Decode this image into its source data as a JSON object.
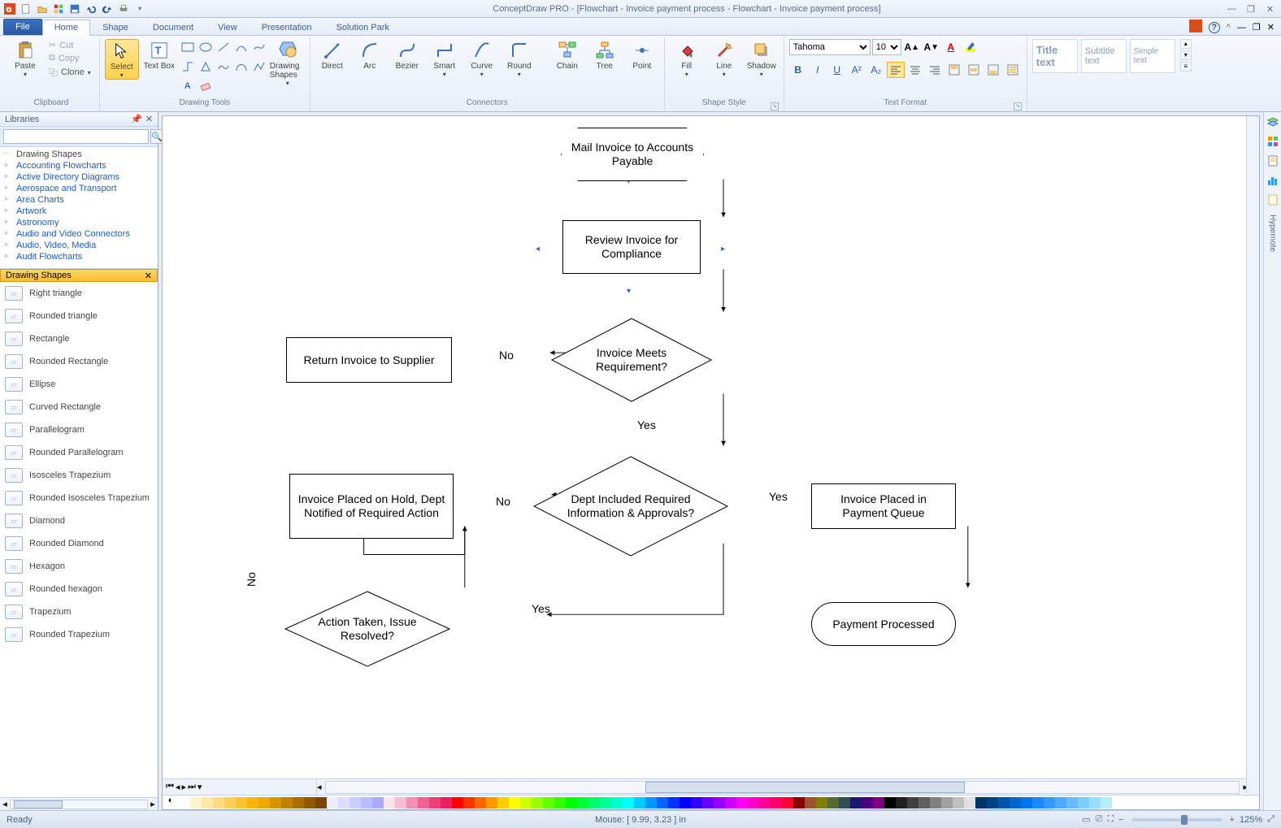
{
  "app": {
    "title": "ConceptDraw PRO - [Flowchart - Invoice payment process - Flowchart - Invoice payment process]"
  },
  "tabs": {
    "file": "File",
    "items": [
      "Home",
      "Shape",
      "Document",
      "View",
      "Presentation",
      "Solution Park"
    ],
    "active": 0
  },
  "ribbon": {
    "clipboard": {
      "paste": "Paste",
      "cut": "Cut",
      "copy": "Copy",
      "clone": "Clone",
      "label": "Clipboard"
    },
    "drawing": {
      "select": "Select",
      "textbox": "Text Box",
      "drawing_shapes": "Drawing Shapes",
      "label": "Drawing Tools"
    },
    "connectors": {
      "direct": "Direct",
      "arc": "Arc",
      "bezier": "Bezier",
      "smart": "Smart",
      "curve": "Curve",
      "round": "Round",
      "chain": "Chain",
      "tree": "Tree",
      "point": "Point",
      "label": "Connectors"
    },
    "shapestyle": {
      "fill": "Fill",
      "line": "Line",
      "shadow": "Shadow",
      "label": "Shape Style"
    },
    "textformat": {
      "font": "Tahoma",
      "size": "10",
      "label": "Text Format"
    },
    "styles": {
      "title": "Title text",
      "subtitle": "Subtitle text",
      "simple": "Simple text"
    }
  },
  "side": {
    "header": "Libraries",
    "tree_header": "Drawing Shapes",
    "tree": [
      "Accounting Flowcharts",
      "Active Directory Diagrams",
      "Aerospace and Transport",
      "Area Charts",
      "Artwork",
      "Astronomy",
      "Audio and Video Connectors",
      "Audio, Video, Media",
      "Audit Flowcharts"
    ],
    "palette_header": "Drawing Shapes",
    "palette": [
      "Right triangle",
      "Rounded triangle",
      "Rectangle",
      "Rounded Rectangle",
      "Ellipse",
      "Curved Rectangle",
      "Parallelogram",
      "Rounded Parallelogram",
      "Isosceles Trapezium",
      "Rounded Isosceles Trapezium",
      "Diamond",
      "Rounded Diamond",
      "Hexagon",
      "Rounded hexagon",
      "Trapezium",
      "Rounded Trapezium"
    ]
  },
  "flow": {
    "n1": "Mail Invoice to Accounts Payable",
    "n2": "Review Invoice for Compliance",
    "n3": "Invoice Meets Requirement?",
    "n4": "Return Invoice to Supplier",
    "n5": "Dept Included Required Information & Approvals?",
    "n6": "Invoice Placed on Hold, Dept Notified of Required Action",
    "n7": "Invoice Placed in Payment Queue",
    "n8": "Action Taken, Issue Resolved?",
    "n9": "Payment Processed",
    "yes": "Yes",
    "no": "No"
  },
  "status": {
    "ready": "Ready",
    "mouse": "Mouse: [ 9.99, 3.23 ] in",
    "zoom": "125%"
  },
  "hypernote": "Hypernote",
  "colorbar": [
    "#ffffff",
    "#fff4cc",
    "#fde9a6",
    "#fddc7f",
    "#fccf58",
    "#fbc231",
    "#f9b50a",
    "#f0a800",
    "#d99400",
    "#c28000",
    "#ab6d00",
    "#945900",
    "#7d4500",
    "#eeeeff",
    "#ddddff",
    "#ccccff",
    "#bbbbff",
    "#aaaaff",
    "#fce4ec",
    "#f8bbd0",
    "#f48fb1",
    "#f06292",
    "#ec407a",
    "#e91e63",
    "#ff0000",
    "#ff3300",
    "#ff6600",
    "#ff9900",
    "#ffcc00",
    "#ffff00",
    "#ccff00",
    "#99ff00",
    "#66ff00",
    "#33ff00",
    "#00ff00",
    "#00ff33",
    "#00ff66",
    "#00ff99",
    "#00ffcc",
    "#00ffff",
    "#00ccff",
    "#0099ff",
    "#0066ff",
    "#0033ff",
    "#0000ff",
    "#3300ff",
    "#6600ff",
    "#9900ff",
    "#cc00ff",
    "#ff00ff",
    "#ff00cc",
    "#ff0099",
    "#ff0066",
    "#ff0033",
    "#8b0000",
    "#a0522d",
    "#808000",
    "#556b2f",
    "#2f4f4f",
    "#191970",
    "#4b0082",
    "#800080",
    "#000000",
    "#202020",
    "#404040",
    "#606060",
    "#808080",
    "#a0a0a0",
    "#c0c0c0",
    "#e0e0e0",
    "#003366",
    "#004488",
    "#0055aa",
    "#0066cc",
    "#0077ee",
    "#1a88ff",
    "#3399ff",
    "#4daaff",
    "#66bbff",
    "#80ccff",
    "#99ddff",
    "#b3eeff"
  ]
}
